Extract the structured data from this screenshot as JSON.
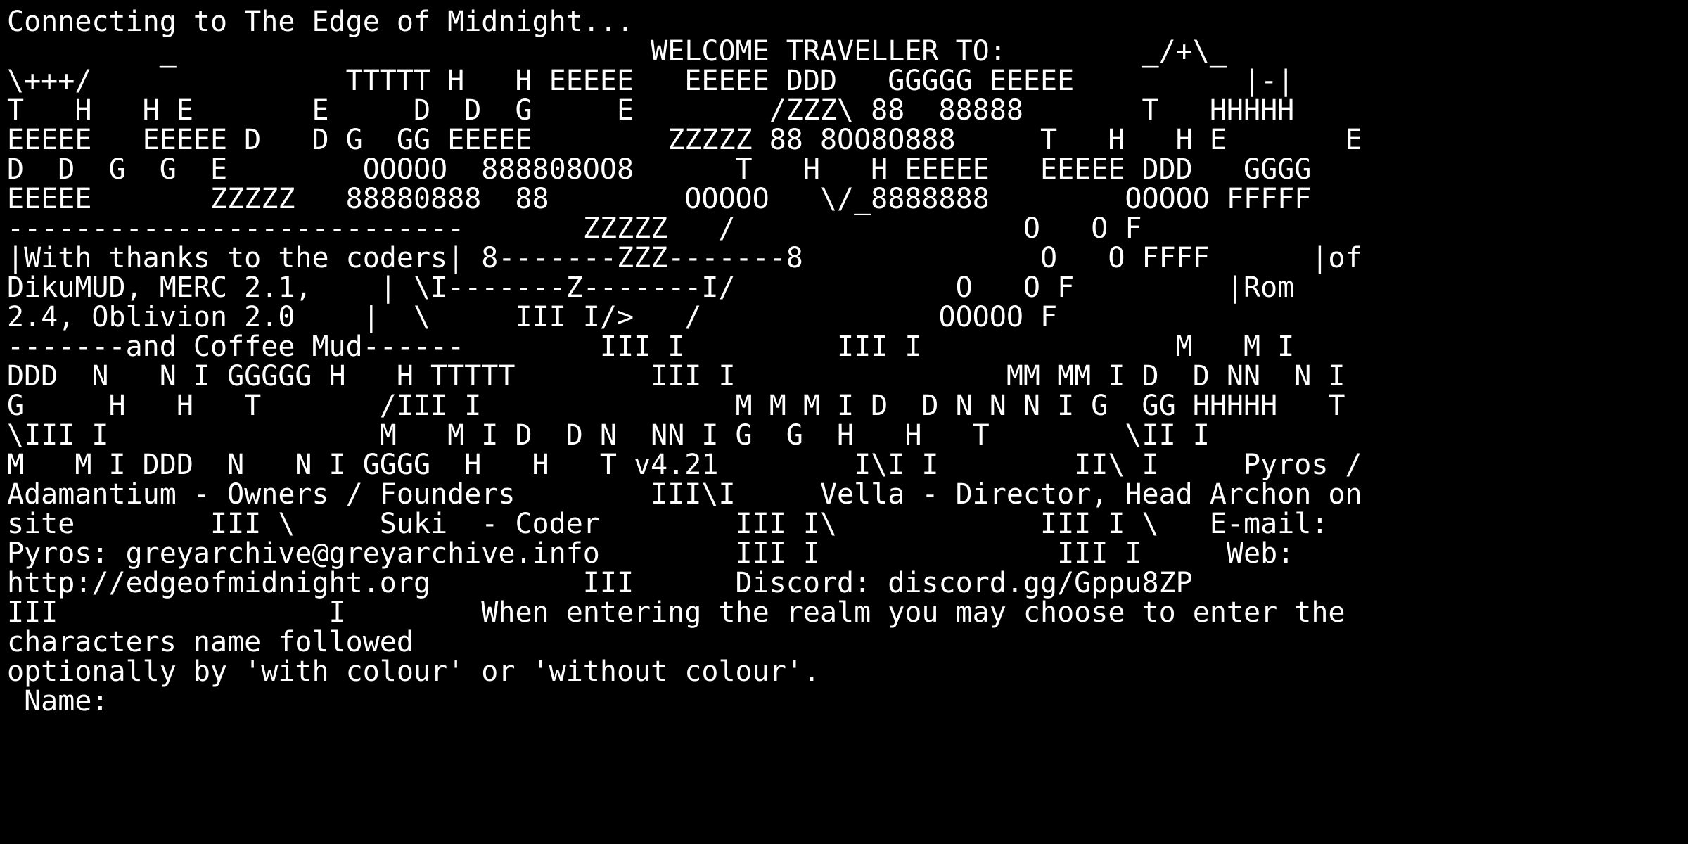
{
  "terminal": {
    "background": "#000000",
    "foreground": "#ffffff",
    "lines": [
      "Connecting to The Edge of Midnight...",
      "         _                            WELCOME TRAVELLER TO:        _/+\\_",
      "\\+++/               TTTTT H   H EEEEE   EEEEE DDD   GGGGG EEEEE          |-|",
      "T   H   H E       E     D  D  G     E        /ZZZ\\ 88  88888       T   HHHHH",
      "EEEEE   EEEEE D   D G  GG EEEEE        ZZZZZ 88 8OO8O888     T   H   H E       E",
      "D  D  G  G  E        OOOOO  888808OO8      T   H   H EEEEE   EEEEE DDD   GGGG",
      "EEEEE       ZZZZZ   88880888  88        OOOOO   \\/_8888888        OOOOO FFFFF",
      "---------------------------       ZZZZZ   /                 O   O F",
      "|With thanks to the coders| 8-------ZZZ-------8              O   O FFFF      |of",
      "DikuMUD, MERC 2.1,    | \\I-------Z-------I/             O   O F         |Rom",
      "2.4, Oblivion 2.0    |  \\     III I/>   /              OOOOO F",
      "-------and Coffee Mud------        III I         III I               M   M I",
      "DDD  N   N I GGGGG H   H TTTTT        III I                MM MM I D  D NN  N I",
      "G     H   H   T       /III I               M M M I D  D N N N I G  GG HHHHH   T",
      "\\III I                M   M I D  D N  NN I G  G  H   H   T        \\II I",
      "M   M I DDD  N   N I GGGG  H   H   T v4.21        I\\I I        II\\ I     Pyros /",
      "Adamantium - Owners / Founders        III\\I     Vella - Director, Head Archon on",
      "site        III \\     Suki  - Coder        III I\\            III I \\   E-mail:",
      "Pyros: greyarchive@greyarchive.info        III I              III I     Web:",
      "http://edgeofmidnight.org         III      Discord: discord.gg/Gppu8ZP",
      "III                I        When entering the realm you may choose to enter the",
      "characters name followed",
      "optionally by 'with colour' or 'without colour'."
    ],
    "prompt": " Name: ",
    "input_value": ""
  }
}
